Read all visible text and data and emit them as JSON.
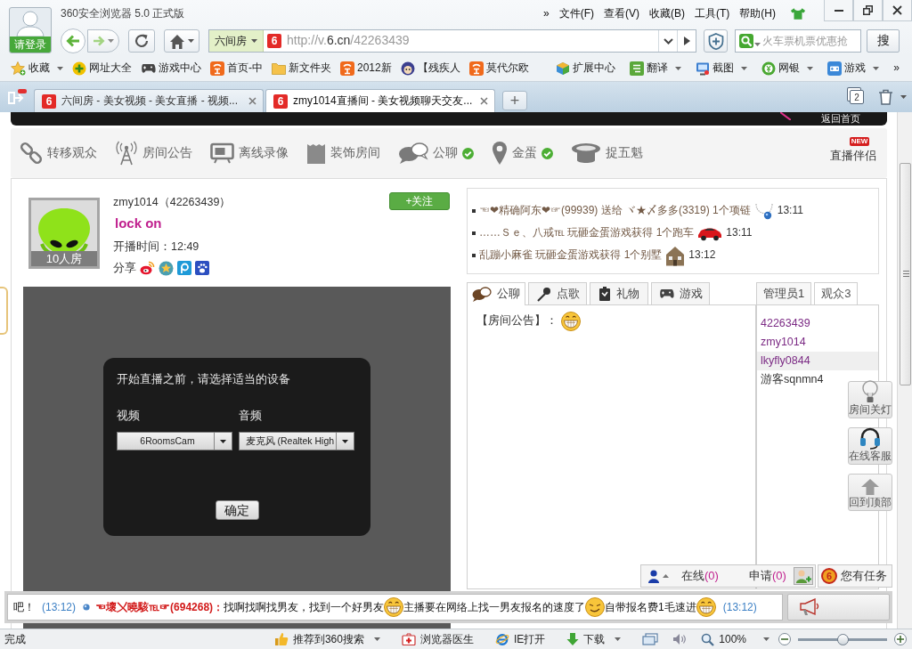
{
  "browser": {
    "title": "360安全浏览器 5.0 正式版",
    "login_label": "请登录",
    "menu_overflow": "»",
    "menus": [
      "文件(F)",
      "查看(V)",
      "收藏(B)",
      "工具(T)",
      "帮助(H)"
    ],
    "address": {
      "site_label": "六间房",
      "logo": "6",
      "url_start": "http://v.",
      "url_domain": "6.cn",
      "url_path": "/42263439"
    },
    "search": {
      "placeholder": "火车票机票优惠抢",
      "button": "搜"
    }
  },
  "bookmarks": {
    "left": [
      {
        "label": "收藏",
        "has_menu": true
      },
      {
        "label": "网址大全",
        "has_menu": false
      },
      {
        "label": "游戏中心",
        "has_menu": false
      },
      {
        "label": "首页-中",
        "has_menu": false
      },
      {
        "label": "新文件夹",
        "has_menu": false
      },
      {
        "label": "2012新",
        "has_menu": false
      },
      {
        "label": "【残疾人",
        "has_menu": false
      },
      {
        "label": "莫代尔欧",
        "has_menu": false
      }
    ],
    "right": [
      {
        "label": "扩展中心",
        "has_menu": false
      },
      {
        "label": "翻译",
        "has_menu": true
      },
      {
        "label": "截图",
        "has_menu": true
      },
      {
        "label": "网银",
        "has_menu": true
      },
      {
        "label": "游戏",
        "has_menu": true
      }
    ],
    "overflow": "»"
  },
  "tabs": [
    {
      "logo": "6",
      "title": "六间房 - 美女视频 - 美女直播 - 视频...",
      "selected": false
    },
    {
      "logo": "6",
      "title": "zmy1014直播间 - 美女视频聊天交友...",
      "selected": true
    }
  ],
  "tab_bar": {
    "new_tab": "+",
    "tab_count": "2"
  },
  "site": {
    "home_link": "返回首页",
    "tools": [
      {
        "label": "转移观众",
        "checked": false
      },
      {
        "label": "房间公告",
        "checked": false
      },
      {
        "label": "离线录像",
        "checked": false
      },
      {
        "label": "装饰房间",
        "checked": false
      },
      {
        "label": "公聊",
        "checked": true
      },
      {
        "label": "金蛋",
        "checked": true
      },
      {
        "label": "捉五魁",
        "checked": false
      }
    ],
    "companion": {
      "badge": "NEW",
      "label": "直播伴侣"
    }
  },
  "anchor": {
    "room_size": "10人房",
    "name": "zmy1014（42263439）",
    "title": "lock on",
    "start_time": "开播时间：12:49",
    "share_label": "分享",
    "follow_button": "+关注"
  },
  "device_dialog": {
    "title": "开始直播之前，请选择适当的设备",
    "video_label": "视频",
    "video_device": "6RoomsCam",
    "audio_label": "音频",
    "audio_device": "麦克风 (Realtek High",
    "confirm": "确定"
  },
  "gift_feed": [
    {
      "text": "☜❤精确阿东❤☞(99939) 送给 ヾ★〆多多(3319) 1个项链",
      "time": "13:11"
    },
    {
      "text": "……Ｓｅ、八戒℡ 玩砸金蛋游戏获得 1个跑车",
      "time": "13:11"
    },
    {
      "text": "乱蹦小麻雀 玩砸金蛋游戏获得 1个别墅",
      "time": "13:12"
    }
  ],
  "chat": {
    "tabs": [
      {
        "label": "公聊",
        "selected": true
      },
      {
        "label": "点歌",
        "selected": false
      },
      {
        "label": "礼物",
        "selected": false
      },
      {
        "label": "游戏",
        "selected": false
      }
    ],
    "notice": "【房间公告】："
  },
  "audience": {
    "tabs": [
      {
        "label": "管理员1",
        "selected": false
      },
      {
        "label": "观众3",
        "selected": true
      }
    ],
    "users": [
      {
        "name": "42263439",
        "color": "#7b2a84",
        "selected": false
      },
      {
        "name": "zmy1014",
        "color": "#7b2a84",
        "selected": false
      },
      {
        "name": "lkyfly0844",
        "color": "#7b2a84",
        "selected": true
      },
      {
        "name": "游客sqnmn4",
        "color": "#333333",
        "selected": false
      }
    ]
  },
  "side_buttons": [
    "房间关灯",
    "在线客服",
    "回到顶部"
  ],
  "mic_bar": {
    "online_label": "在线",
    "online_count": "(0)",
    "apply_label": "申请",
    "apply_count": "(0)",
    "task_logo": "6",
    "task_label": "您有任务"
  },
  "ticker": {
    "lead": "吧！",
    "lead_time": "(13:12)",
    "sender": "☜壞〤曉駭℡☞(694268)：",
    "segments": [
      "找啊找啊找男友，找到一个好男友",
      "主播要在网络上找一男友报名的速度了",
      "自带报名费1毛速进"
    ],
    "time": "(13:12)"
  },
  "status_bar": {
    "text": "完成",
    "items": [
      {
        "label": "推荐到360搜索",
        "has_menu": true
      },
      {
        "label": "浏览器医生",
        "has_menu": false
      },
      {
        "label": "IE打开",
        "has_menu": false
      },
      {
        "label": "下载",
        "has_menu": true
      }
    ],
    "zoom": {
      "label": "100%",
      "level": 0.5
    }
  }
}
